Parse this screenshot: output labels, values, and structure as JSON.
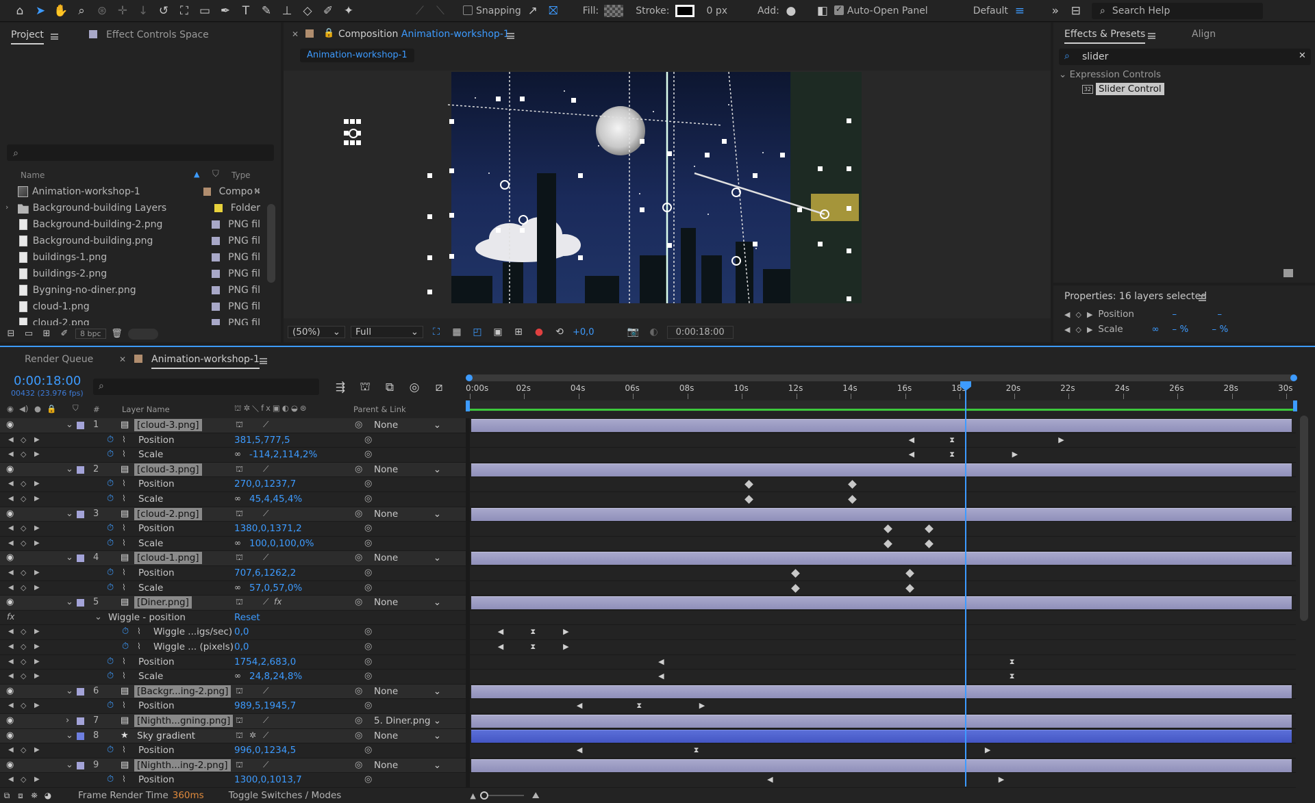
{
  "toolbar": {
    "snapping_label": "Snapping",
    "fill_label": "Fill:",
    "stroke_label": "Stroke:",
    "stroke_width": "0 px",
    "add_label": "Add:",
    "auto_open_label": "Auto-Open Panel",
    "workspace": "Default",
    "search_help": "Search Help"
  },
  "project": {
    "tab_project": "Project",
    "tab_effect": "Effect Controls Space",
    "col_name": "Name",
    "col_type": "Type",
    "bpc": "8 bpc",
    "items": [
      {
        "name": "Animation-workshop-1",
        "type": "Compo",
        "label": "#b08d6e"
      },
      {
        "name": "Background-building Layers",
        "type": "Folder",
        "label": "#e8d23c"
      },
      {
        "name": "Background-building-2.png",
        "type": "PNG fil",
        "label": "#a8a8c8"
      },
      {
        "name": "Background-building.png",
        "type": "PNG fil",
        "label": "#a8a8c8"
      },
      {
        "name": "buildings-1.png",
        "type": "PNG fil",
        "label": "#a8a8c8"
      },
      {
        "name": "buildings-2.png",
        "type": "PNG fil",
        "label": "#a8a8c8"
      },
      {
        "name": "Bygning-no-diner.png",
        "type": "PNG fil",
        "label": "#a8a8c8"
      },
      {
        "name": "cloud-1.png",
        "type": "PNG fil",
        "label": "#a8a8c8"
      },
      {
        "name": "cloud-2.png",
        "type": "PNG fil",
        "label": "#a8a8c8"
      }
    ]
  },
  "composition": {
    "tab_prefix": "Composition",
    "tab_name": "Animation-workshop-1",
    "subtab": "Animation-workshop-1",
    "zoom": "(50%)",
    "resolution": "Full",
    "exposure": "+0,0",
    "timecode": "0:00:18:00"
  },
  "effects": {
    "tab_effects": "Effects & Presets",
    "tab_align": "Align",
    "search_value": "slider",
    "category": "Expression Controls",
    "item": "Slider Control",
    "properties_title": "Properties: 16 layers selected",
    "prop_position": "Position",
    "prop_scale": "Scale",
    "prop_value1": "–",
    "prop_value2": "–",
    "prop_pct1": "– %",
    "prop_pct2": "– %"
  },
  "timeline": {
    "tab_render": "Render Queue",
    "tab_comp": "Animation-workshop-1",
    "timecode": "0:00:18:00",
    "frames": "00432 (23.976 fps)",
    "col_layer_name": "Layer Name",
    "col_parent": "Parent & Link",
    "col_hash": "#",
    "ruler": [
      "0:00s",
      "02s",
      "04s",
      "06s",
      "08s",
      "10s",
      "12s",
      "14s",
      "16s",
      "18s",
      "20s",
      "22s",
      "24s",
      "26s",
      "28s",
      "30s"
    ],
    "frame_render_label": "Frame Render Time",
    "frame_render_value": "360ms",
    "toggle_label": "Toggle Switches / Modes",
    "rows": [
      {
        "kind": "layer",
        "num": "1",
        "name": "[cloud-3.png]",
        "parent": "None"
      },
      {
        "kind": "prop",
        "name": "Position",
        "value": "381,5,777,5"
      },
      {
        "kind": "prop",
        "name": "Scale",
        "value": "-114,2,114,2%",
        "link": true
      },
      {
        "kind": "layer",
        "num": "2",
        "name": "[cloud-3.png]",
        "parent": "None"
      },
      {
        "kind": "prop",
        "name": "Position",
        "value": "270,0,1237,7"
      },
      {
        "kind": "prop",
        "name": "Scale",
        "value": "45,4,45,4%",
        "link": true
      },
      {
        "kind": "layer",
        "num": "3",
        "name": "[cloud-2.png]",
        "parent": "None"
      },
      {
        "kind": "prop",
        "name": "Position",
        "value": "1380,0,1371,2"
      },
      {
        "kind": "prop",
        "name": "Scale",
        "value": "100,0,100,0%",
        "link": true
      },
      {
        "kind": "layer",
        "num": "4",
        "name": "[cloud-1.png]",
        "parent": "None"
      },
      {
        "kind": "prop",
        "name": "Position",
        "value": "707,6,1262,2"
      },
      {
        "kind": "prop",
        "name": "Scale",
        "value": "57,0,57,0%",
        "link": true
      },
      {
        "kind": "layer",
        "num": "5",
        "name": "[Diner.png]",
        "parent": "None",
        "fx": true
      },
      {
        "kind": "effect",
        "name": "Wiggle - position",
        "value": "Reset"
      },
      {
        "kind": "subprop",
        "name": "Wiggle ...igs/sec)",
        "value": "0,0"
      },
      {
        "kind": "subprop",
        "name": "Wiggle ... (pixels)",
        "value": "0,0"
      },
      {
        "kind": "prop",
        "name": "Position",
        "value": "1754,2,683,0"
      },
      {
        "kind": "prop",
        "name": "Scale",
        "value": "24,8,24,8%",
        "link": true
      },
      {
        "kind": "layer",
        "num": "6",
        "name": "[Backgr...ing-2.png]",
        "parent": "None"
      },
      {
        "kind": "prop",
        "name": "Position",
        "value": "989,5,1945,7"
      },
      {
        "kind": "layer",
        "num": "7",
        "name": "[Nighth...gning.png]",
        "parent": "5. Diner.png",
        "collapsed": true
      },
      {
        "kind": "layer",
        "num": "8",
        "name": "Sky gradient",
        "parent": "None",
        "star": true,
        "selected": true
      },
      {
        "kind": "prop",
        "name": "Position",
        "value": "996,0,1234,5"
      },
      {
        "kind": "layer",
        "num": "9",
        "name": "[Nighth...ing-2.png]",
        "parent": "None"
      },
      {
        "kind": "prop",
        "name": "Position",
        "value": "1300,0,1013,7"
      }
    ]
  }
}
